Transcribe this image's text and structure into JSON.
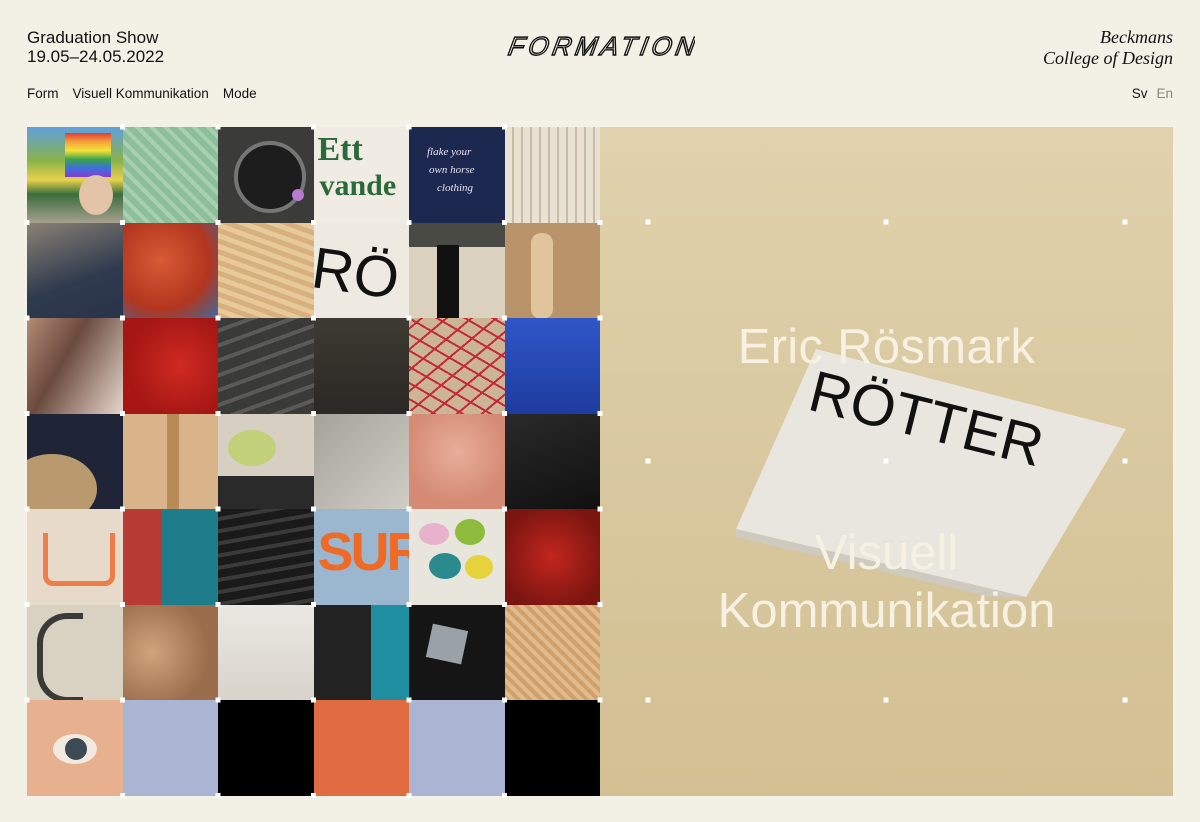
{
  "header": {
    "show_title": "Graduation Show",
    "dates": "19.05–24.05.2022",
    "logo_text": "FORMATION",
    "school_line1": "Beckmans",
    "school_line2": "College of Design"
  },
  "nav": {
    "items": [
      {
        "label": "Form"
      },
      {
        "label": "Visuell Kommunikation"
      },
      {
        "label": "Mode"
      }
    ]
  },
  "language": {
    "sv": "Sv",
    "en": "En",
    "active": "Sv"
  },
  "grid": {
    "tile_texts": {
      "ett_line1": "Ett",
      "ett_line2": "vande",
      "horse_line1": "flake your",
      "horse_line2": "own horse",
      "horse_line3": "clothing",
      "rot_fragment": "RÖ",
      "sur": "SUR"
    },
    "colors": [
      "#a9b5d2",
      "#000000",
      "#e06b40",
      "#a9b5d2",
      "#000000"
    ]
  },
  "feature": {
    "name": "Eric Rösmark",
    "category_line1": "Visuell",
    "category_line2": "Kommunikation",
    "magazine_title": "RÖTTER"
  }
}
